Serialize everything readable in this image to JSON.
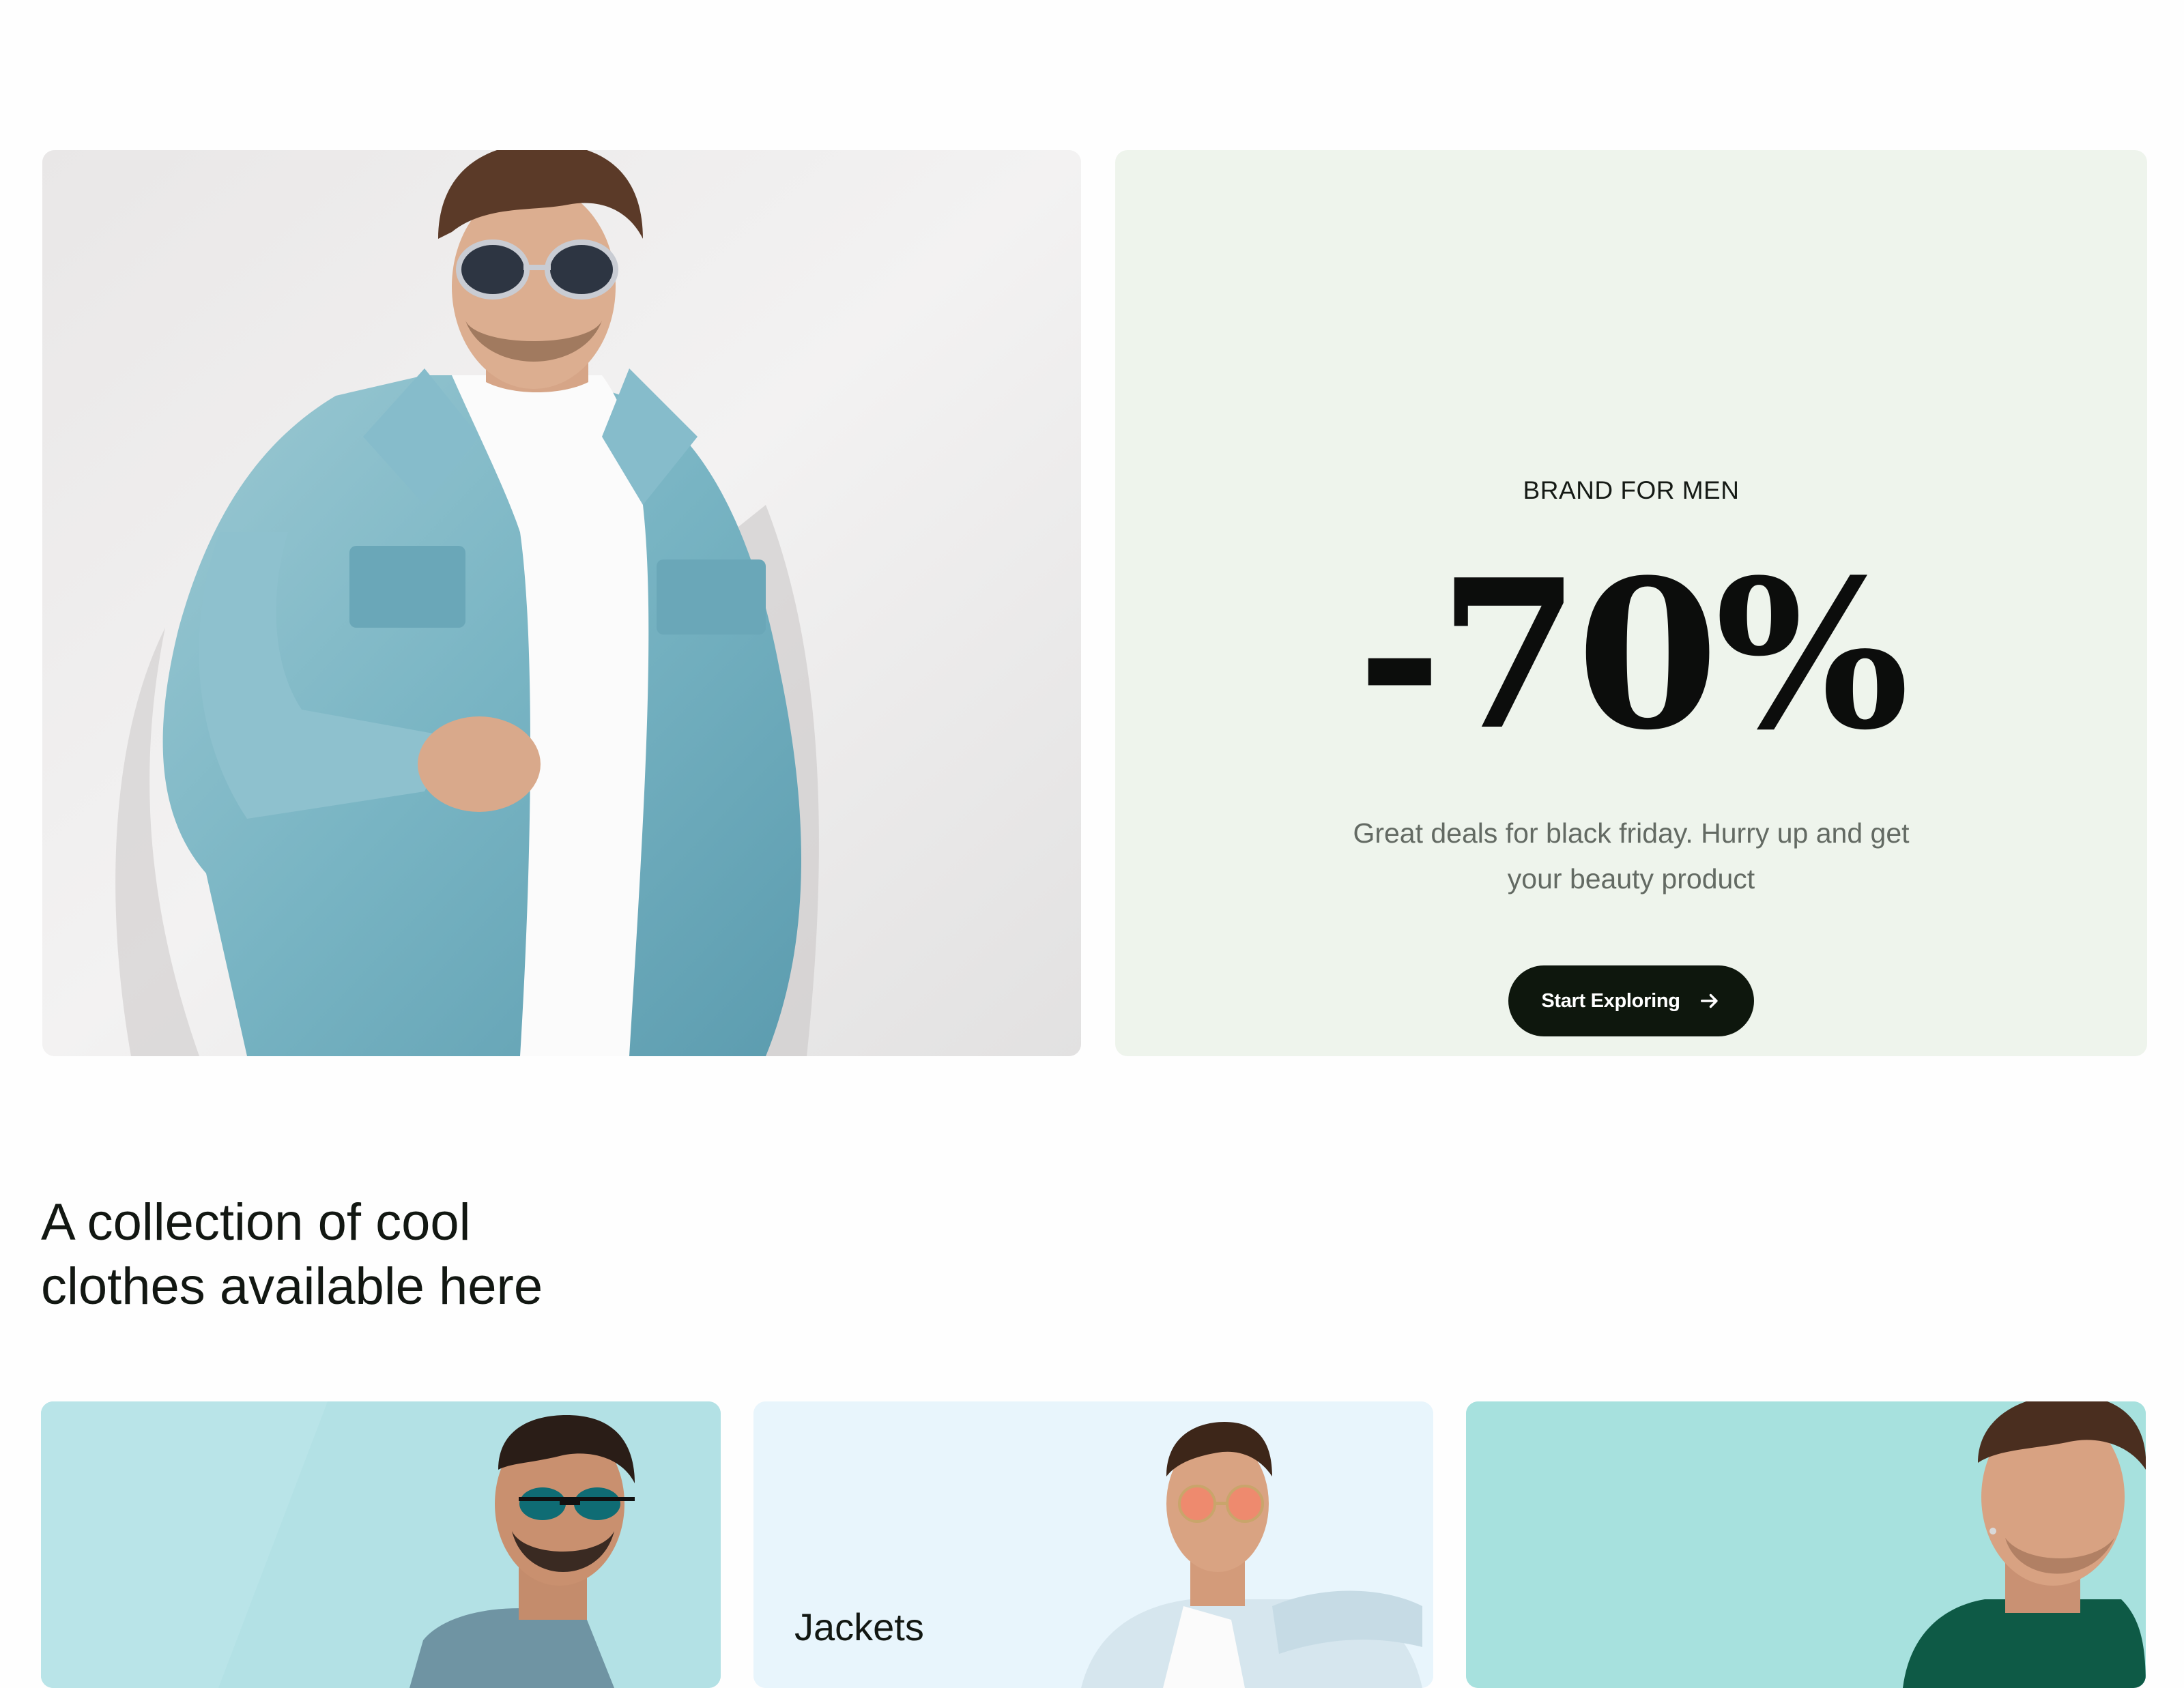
{
  "promo": {
    "eyebrow": "BRAND FOR MEN",
    "discount": "-70%",
    "description": "Great deals for black friday. Hurry up and get your beauty product",
    "cta_label": "Start Exploring",
    "cta_icon": "arrow-right-icon"
  },
  "collection": {
    "heading_line1": "A collection of cool",
    "heading_line2": "clothes available here"
  },
  "categories": [
    {
      "label": ""
    },
    {
      "label": "Jackets"
    },
    {
      "label": ""
    }
  ],
  "colors": {
    "promo_bg": "#eef4ec",
    "cta_bg": "#0e170d",
    "category_1_bg": "#b3e1e5",
    "category_2_bg": "#e8f5fc",
    "category_3_bg": "#a7e1de"
  }
}
